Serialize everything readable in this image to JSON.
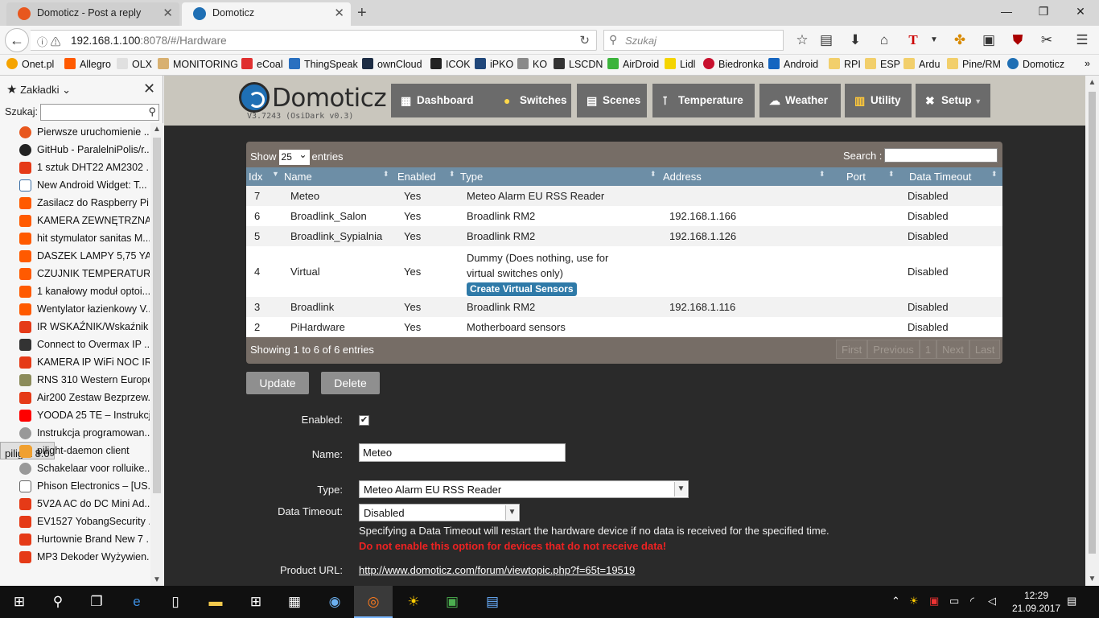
{
  "browser": {
    "tabs": [
      {
        "title": "Domoticz - Post a reply",
        "active": false
      },
      {
        "title": "Domoticz",
        "active": true
      }
    ],
    "url_host": "192.168.1.100",
    "url_rest": ":8078/#/Hardware",
    "search_placeholder": "Szukaj",
    "bookmarks": [
      "Onet.pl",
      "Allegro",
      "OLX",
      "MONITORING",
      "eCoal",
      "ThingSpeak",
      "ownCloud",
      "ICOK",
      "iPKO",
      "KO",
      "LSCDN",
      "AirDroid",
      "Lidl",
      "Biedronka",
      "Android",
      "RPI",
      "ESP",
      "Ardu",
      "Pine/RM",
      "Domoticz"
    ]
  },
  "sidebar": {
    "title": "Zakładki",
    "search_label": "Szukaj:",
    "items": [
      "Pierwsze uruchomienie ...",
      "GitHub - ParalelniPolis/r...",
      "1 sztuk DHT22 AM2302 ...",
      "New Android Widget: T...",
      "Zasilacz do Raspberry Pi...",
      "KAMERA ZEWNĘTRZNA...",
      "hit stymulator sanitas M...",
      "DASZEK LAMPY 5,75 YA...",
      "CZUJNIK TEMPERATUR...",
      "1 kanałowy moduł optoi...",
      "Wentylator łazienkowy V...",
      "IR WSKAŹNIK/Wskaźnik ...",
      "Connect to Overmax IP ...",
      "KAMERA IP WiFi NOC IR...",
      "RNS 310 Western Europe...",
      "Air200 Zestaw Bezprzew...",
      "YOODA 25 TE – Instrukcj...",
      "Instrukcja programowan...",
      "pilight 8.0",
      "pilight-daemon client",
      "Schakelaar voor rolluike...",
      "Phison Electronics – [US...",
      "5V2A AC do DC Mini Ad...",
      "EV1527 YobangSecurity ...",
      "Hurtownie Brand New 7 ...",
      "MP3 Dekoder Wyżywien..."
    ]
  },
  "app": {
    "brand": "Domoticz",
    "version": "V3.7243 (OsiDark v0.3)",
    "menu": [
      "Dashboard",
      "Switches",
      "Scenes",
      "Temperature",
      "Weather",
      "Utility",
      "Setup"
    ]
  },
  "table": {
    "show_label": "Show",
    "show_value": "25",
    "entries_label": "entries",
    "search_label": "Search :",
    "columns": [
      "Idx",
      "Name",
      "Enabled",
      "Type",
      "Address",
      "Port",
      "Data Timeout"
    ],
    "rows": [
      {
        "idx": "7",
        "name": "Meteo",
        "enabled": "Yes",
        "type": "Meteo Alarm EU RSS Reader",
        "address": "",
        "port": "",
        "timeout": "Disabled"
      },
      {
        "idx": "6",
        "name": "Broadlink_Salon",
        "enabled": "Yes",
        "type": "Broadlink RM2",
        "address": "192.168.1.166",
        "port": "",
        "timeout": "Disabled"
      },
      {
        "idx": "5",
        "name": "Broadlink_Sypialnia",
        "enabled": "Yes",
        "type": "Broadlink RM2",
        "address": "192.168.1.126",
        "port": "",
        "timeout": "Disabled"
      },
      {
        "idx": "4",
        "name": "Virtual",
        "enabled": "Yes",
        "type_line1": "Dummy (Does nothing, use for",
        "type_line2": "virtual switches only)",
        "type_button": "Create Virtual Sensors",
        "address": "",
        "port": "",
        "timeout": "Disabled"
      },
      {
        "idx": "3",
        "name": "Broadlink",
        "enabled": "Yes",
        "type": "Broadlink RM2",
        "address": "192.168.1.116",
        "port": "",
        "timeout": "Disabled"
      },
      {
        "idx": "2",
        "name": "PiHardware",
        "enabled": "Yes",
        "type": "Motherboard sensors",
        "address": "",
        "port": "",
        "timeout": "Disabled"
      }
    ],
    "showing": "Showing 1 to 6 of 6 entries",
    "pager": [
      "First",
      "Previous",
      "1",
      "Next",
      "Last"
    ]
  },
  "form": {
    "update_label": "Update",
    "delete_label": "Delete",
    "enabled_label": "Enabled:",
    "enabled_checked": "✔",
    "name_label": "Name:",
    "name_value": "Meteo",
    "type_label": "Type:",
    "type_value": "Meteo Alarm EU RSS Reader",
    "timeout_label": "Data Timeout:",
    "timeout_value": "Disabled",
    "timeout_note": "Specifying a Data Timeout will restart the hardware device if no data is received for the specified time.",
    "timeout_warning": "Do not enable this option for devices that do not receive data!",
    "product_url_label": "Product URL:",
    "product_url": "http://www.domoticz.com/forum/viewtopic.php?f=65t=19519"
  },
  "taskbar": {
    "time": "12:29",
    "date": "21.09.2017"
  }
}
